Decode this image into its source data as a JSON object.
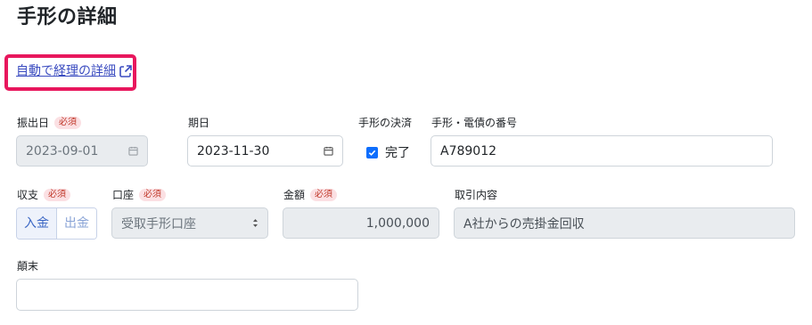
{
  "page": {
    "title": "手形の詳細"
  },
  "link": {
    "label": "自動で経理の詳細"
  },
  "fields": {
    "issue_date": {
      "label": "振出日",
      "required": "必須",
      "value": "2023-09-01"
    },
    "due_date": {
      "label": "期日",
      "value": "2023-11-30"
    },
    "settlement": {
      "label": "手形の決済",
      "checkbox_label": "完了",
      "checked": true
    },
    "bill_number": {
      "label": "手形・電債の番号",
      "value": "A789012"
    },
    "income_expense": {
      "label": "収支",
      "required": "必須",
      "options": [
        "入金",
        "出金"
      ],
      "selected": "入金"
    },
    "account": {
      "label": "口座",
      "required": "必須",
      "value": "受取手形口座"
    },
    "amount": {
      "label": "金額",
      "required": "必須",
      "value": "1,000,000"
    },
    "transaction": {
      "label": "取引内容",
      "value": "A社からの売掛金回収"
    },
    "notes": {
      "label": "顛末",
      "value": ""
    }
  },
  "colors": {
    "highlight": "#e8175d",
    "link": "#3b4cc0",
    "checkbox": "#0d6efd"
  }
}
